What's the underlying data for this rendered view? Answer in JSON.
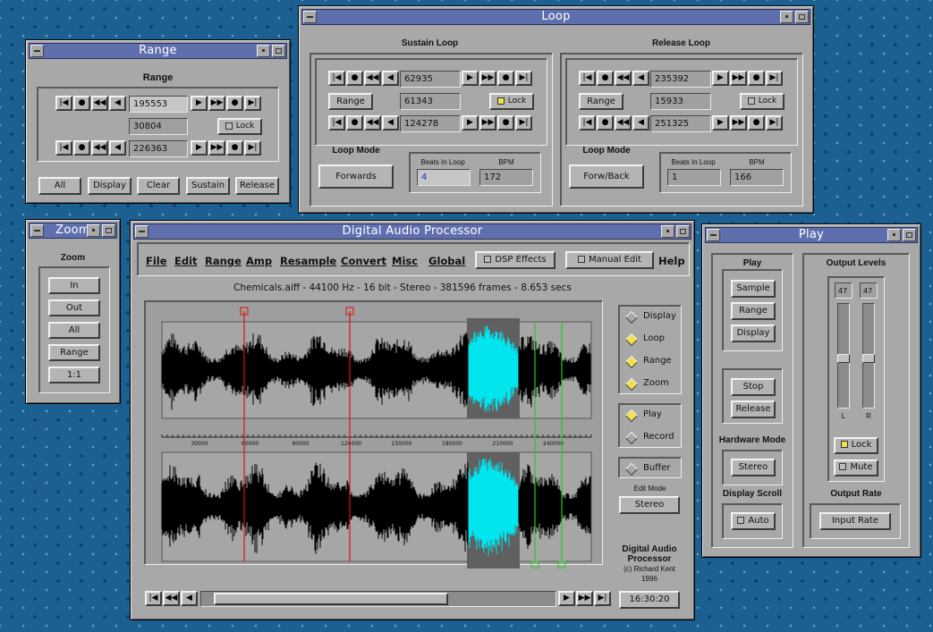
{
  "range": {
    "title": "Range",
    "section": "Range",
    "start": "195553",
    "length": "30804",
    "end": "226363",
    "lock": "Lock",
    "buttons": [
      "All",
      "Display",
      "Clear",
      "Sustain",
      "Release"
    ]
  },
  "loop": {
    "title": "Loop",
    "sustain": {
      "title": "Sustain Loop",
      "start": "62935",
      "length": "61343",
      "end": "124278",
      "range": "Range",
      "lock": "Lock",
      "mode_label": "Loop Mode",
      "mode": "Forwards",
      "beats_label": "Beats In Loop",
      "beats": "4",
      "bpm_label": "BPM",
      "bpm": "172"
    },
    "release": {
      "title": "Release Loop",
      "start": "235392",
      "length": "15933",
      "end": "251325",
      "range": "Range",
      "lock": "Lock",
      "mode_label": "Loop Mode",
      "mode": "Forw/Back",
      "beats_label": "Beats In Loop",
      "beats": "1",
      "bpm_label": "BPM",
      "bpm": "166"
    }
  },
  "zoom": {
    "title": "Zoom",
    "section": "Zoom",
    "buttons": [
      "In",
      "Out",
      "All",
      "Range",
      "1:1"
    ]
  },
  "dap": {
    "title": "Digital Audio Processor",
    "menu": [
      "File",
      "Edit",
      "Range",
      "Amp",
      "Resample",
      "Convert",
      "Misc",
      "Global"
    ],
    "dsp": "DSP Effects",
    "manual": "Manual Edit",
    "help": "Help",
    "info": "Chemicals.aiff  -  44100 Hz  -  16 bit  -  Stereo  -  381596 frames  -  8.653 secs",
    "ticks": [
      "30000",
      "60000",
      "90000",
      "120000",
      "150000",
      "180000",
      "210000",
      "240000"
    ],
    "view": [
      "Display",
      "Loop",
      "Range",
      "Zoom"
    ],
    "view_on": [
      false,
      true,
      true,
      true
    ],
    "mode": [
      "Play",
      "Record"
    ],
    "mode_on": [
      true,
      false
    ],
    "buffer": "Buffer",
    "edit_mode_label": "Edit Mode",
    "edit_mode": "Stereo",
    "credit": [
      "Digital Audio",
      "Processor",
      "(c) Richard Kent",
      "1996"
    ],
    "time": "16:30:20"
  },
  "play": {
    "title": "Play",
    "section": "Play",
    "buttons": [
      "Sample",
      "Range",
      "Display"
    ],
    "stop": "Stop",
    "release": "Release",
    "hw_label": "Hardware Mode",
    "hw": "Stereo",
    "scroll_label": "Display Scroll",
    "auto": "Auto",
    "levels_label": "Output Levels",
    "left_level": "47",
    "right_level": "47",
    "l": "L",
    "r": "R",
    "lock": "Lock",
    "mute": "Mute",
    "rate_label": "Output Rate",
    "rate_btn": "Input Rate"
  },
  "colors": {
    "desktop": "#1c5f91",
    "title": "#5f6fae",
    "panel": "#a8a8a8",
    "wave": "#000000",
    "highlight": "#00e5ee",
    "range_marker": "#dd1111",
    "loop_marker": "#22cc22",
    "lamp": "#f0e04a"
  }
}
